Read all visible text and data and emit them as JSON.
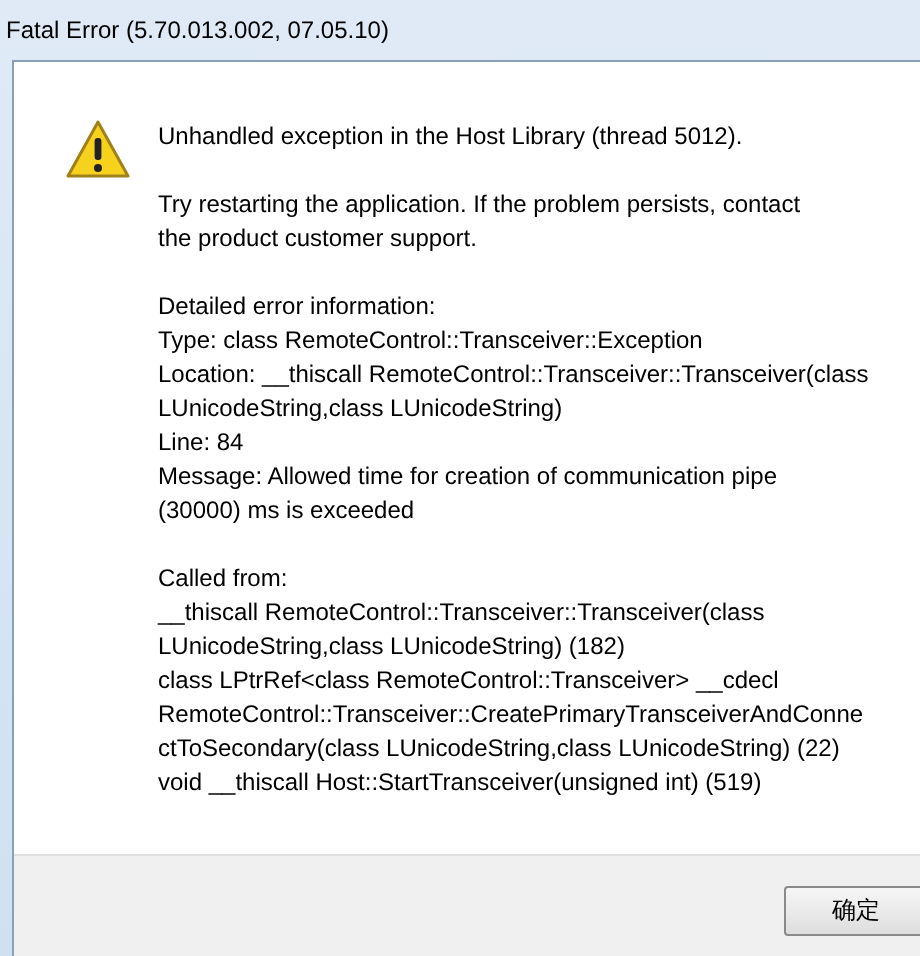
{
  "window": {
    "title": "Fatal Error (5.70.013.002, 07.05.10)"
  },
  "message": {
    "heading": "Unhandled exception in the Host Library (thread 5012).",
    "advice_lines": [
      "Try restarting the application. If the problem persists, contact",
      "the product customer support."
    ],
    "detail_lines": [
      "Detailed error information:",
      "Type: class RemoteControl::Transceiver::Exception",
      "Location: __thiscall RemoteControl::Transceiver::Transceiver(class",
      "LUnicodeString,class LUnicodeString)",
      "Line: 84",
      "Message: Allowed time for creation of communication pipe",
      "(30000) ms is exceeded"
    ],
    "called_from_lines": [
      "Called from:",
      "__thiscall RemoteControl::Transceiver::Transceiver(class",
      "LUnicodeString,class LUnicodeString) (182)",
      "class LPtrRef<class RemoteControl::Transceiver> __cdecl",
      "RemoteControl::Transceiver::CreatePrimaryTransceiverAndConne",
      "ctToSecondary(class LUnicodeString,class LUnicodeString) (22)",
      "void __thiscall Host::StartTransceiver(unsigned int) (519)"
    ]
  },
  "buttons": [
    "确定"
  ]
}
